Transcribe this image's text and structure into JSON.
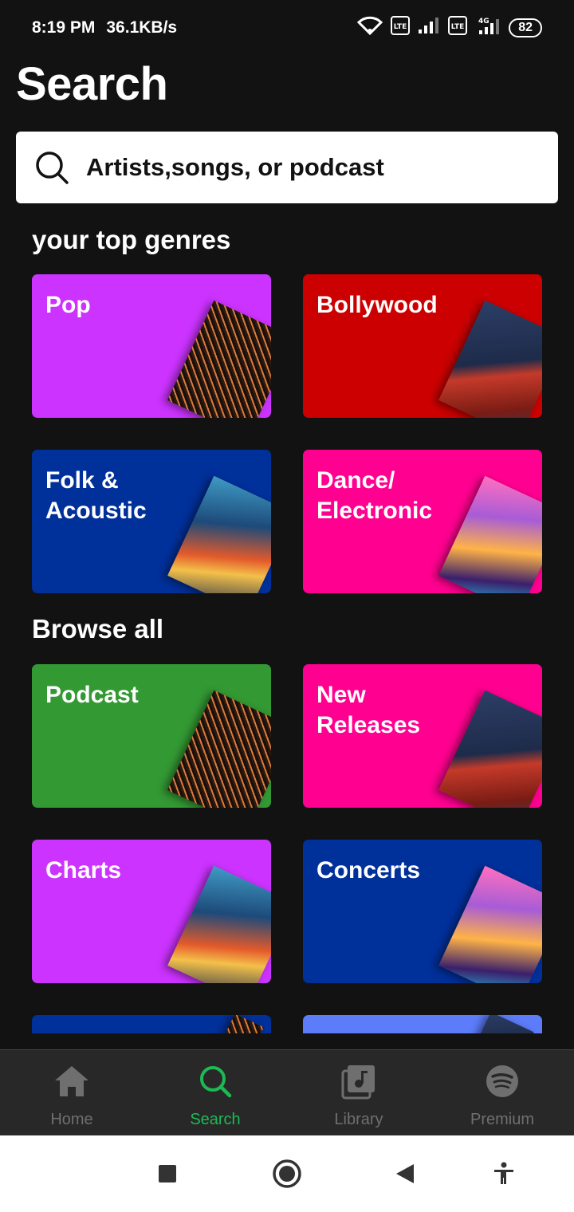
{
  "status_bar": {
    "time": "8:19 PM",
    "speed": "36.1KB/s",
    "battery": "82",
    "icons": [
      "wifi-icon",
      "volte-icon",
      "signal-icon",
      "volte-icon",
      "4g-signal-icon",
      "battery-icon"
    ]
  },
  "page": {
    "title": "Search"
  },
  "search": {
    "placeholder": "Artists,songs, or podcast",
    "icon": "search-icon"
  },
  "sections": {
    "top_genres": "your top genres",
    "browse_all": "Browse all"
  },
  "top_genres": [
    {
      "label": "Pop",
      "color": "#cc33ff"
    },
    {
      "label": "Bollywood",
      "color": "#cc0000"
    },
    {
      "label": "Folk &\nAcoustic",
      "color": "#00309a"
    },
    {
      "label": "Dance/\nElectronic",
      "color": "#ff0090"
    }
  ],
  "browse_all": [
    {
      "label": "Podcast",
      "color": "#339933"
    },
    {
      "label": "New\nReleases",
      "color": "#ff0090"
    },
    {
      "label": "Charts",
      "color": "#cc33ff"
    },
    {
      "label": "Concerts",
      "color": "#00309a"
    },
    {
      "label": "",
      "color": "#00309a"
    },
    {
      "label": "",
      "color": "#5c7cfa"
    }
  ],
  "bottom_nav": [
    {
      "label": "Home",
      "icon": "home-icon",
      "active": false
    },
    {
      "label": "Search",
      "icon": "search-icon",
      "active": true
    },
    {
      "label": "Library",
      "icon": "library-icon",
      "active": false
    },
    {
      "label": "Premium",
      "icon": "spotify-icon",
      "active": false
    }
  ],
  "colors": {
    "background": "#121212",
    "accent": "#1db954",
    "nav_bg": "#282828"
  }
}
